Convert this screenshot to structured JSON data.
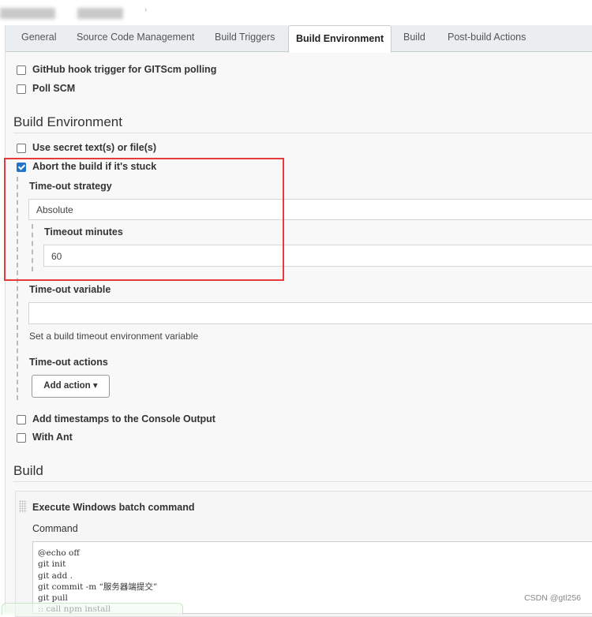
{
  "breadcrumb": {
    "separator": "›"
  },
  "tabs": [
    {
      "label": "General",
      "active": false
    },
    {
      "label": "Source Code Management",
      "active": false
    },
    {
      "label": "Build Triggers",
      "active": false
    },
    {
      "label": "Build Environment",
      "active": true
    },
    {
      "label": "Build",
      "active": false
    },
    {
      "label": "Post-build Actions",
      "active": false
    }
  ],
  "build_triggers": {
    "github_hook": {
      "label": "GitHub hook trigger for GITScm polling",
      "checked": false
    },
    "poll_scm": {
      "label": "Poll SCM",
      "checked": false
    }
  },
  "build_environment": {
    "title": "Build Environment",
    "use_secret": {
      "label": "Use secret text(s) or file(s)",
      "checked": false
    },
    "abort_stuck": {
      "label": "Abort the build if it's stuck",
      "checked": true
    },
    "timeout_strategy": {
      "label": "Time-out strategy",
      "value": "Absolute"
    },
    "timeout_minutes": {
      "label": "Timeout minutes",
      "value": "60"
    },
    "timeout_variable": {
      "label": "Time-out variable",
      "value": "",
      "help": "Set a build timeout environment variable"
    },
    "timeout_actions": {
      "label": "Time-out actions",
      "add_action_label": "Add action",
      "dropdown_icon": "▾"
    },
    "timestamps": {
      "label": "Add timestamps to the Console Output",
      "checked": false
    },
    "with_ant": {
      "label": "With Ant",
      "checked": false
    }
  },
  "build": {
    "title": "Build",
    "step": {
      "title": "Execute Windows batch command",
      "command_label": "Command",
      "command": "@echo off\ngit init\ngit add .\ngit commit -m “服务器端提交”\ngit pull\n:: call npm install"
    }
  },
  "watermark": "CSDN @gtl256",
  "colors": {
    "highlight_box": "#e83a3a",
    "checkbox_checked": "#2174c8"
  }
}
